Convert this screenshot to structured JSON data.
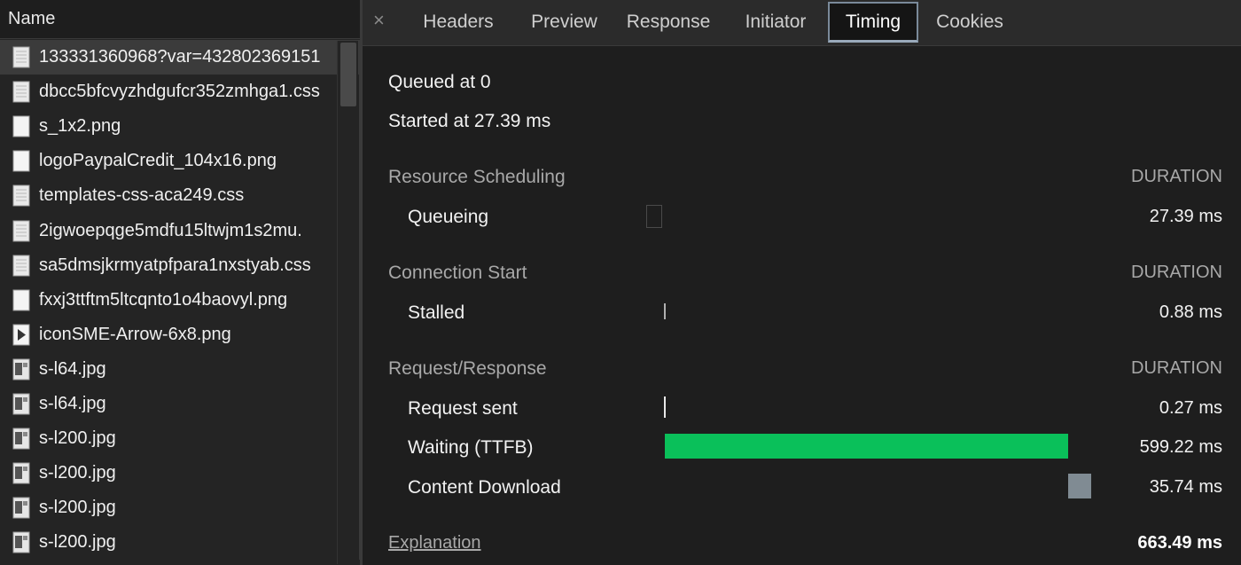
{
  "list": {
    "header": "Name",
    "files": [
      {
        "name": "133331360968?var=432802369151",
        "icon": "document-icon",
        "selected": true
      },
      {
        "name": "dbcc5bfcvyzhdgufcr352zmhga1.css",
        "icon": "document-icon"
      },
      {
        "name": "s_1x2.png",
        "icon": "image-icon"
      },
      {
        "name": "logoPaypalCredit_104x16.png",
        "icon": "image-icon"
      },
      {
        "name": "templates-css-aca249.css",
        "icon": "document-icon"
      },
      {
        "name": "2igwoepqge5mdfu15ltwjm1s2mu.",
        "icon": "document-icon"
      },
      {
        "name": "sa5dmsjkrmyatpfpara1nxstyab.css",
        "icon": "document-icon"
      },
      {
        "name": "fxxj3ttftm5ltcqnto1o4baovyl.png",
        "icon": "image-icon"
      },
      {
        "name": "iconSME-Arrow-6x8.png",
        "icon": "image-icon"
      },
      {
        "name": "s-l64.jpg",
        "icon": "photo-icon"
      },
      {
        "name": "s-l64.jpg",
        "icon": "photo-icon"
      },
      {
        "name": "s-l200.jpg",
        "icon": "photo-icon"
      },
      {
        "name": "s-l200.jpg",
        "icon": "photo-icon"
      },
      {
        "name": "s-l200.jpg",
        "icon": "photo-icon"
      },
      {
        "name": "s-l200.jpg",
        "icon": "photo-icon"
      }
    ]
  },
  "tabs": {
    "close": "×",
    "items": [
      "Headers",
      "Preview",
      "Response",
      "Initiator",
      "Timing",
      "Cookies"
    ],
    "active": "Timing"
  },
  "timing": {
    "queued": "Queued at 0",
    "started": "Started at 27.39 ms",
    "duration_header": "DURATION",
    "sections": [
      {
        "title": "Resource Scheduling",
        "rows": [
          {
            "label": "Queueing",
            "value": "27.39 ms",
            "bar_color": "#1e1e1e"
          }
        ]
      },
      {
        "title": "Connection Start",
        "rows": [
          {
            "label": "Stalled",
            "value": "0.88 ms",
            "bar_color": "#b0b0b0"
          }
        ]
      },
      {
        "title": "Request/Response",
        "rows": [
          {
            "label": "Request sent",
            "value": "0.27 ms",
            "bar_color": "#e8e8e8"
          },
          {
            "label": "Waiting (TTFB)",
            "value": "599.22 ms",
            "bar_color": "#0ac05a"
          },
          {
            "label": "Content Download",
            "value": "35.74 ms",
            "bar_color": "#808b93"
          }
        ]
      }
    ],
    "explanation": "Explanation",
    "total": "663.49 ms"
  }
}
